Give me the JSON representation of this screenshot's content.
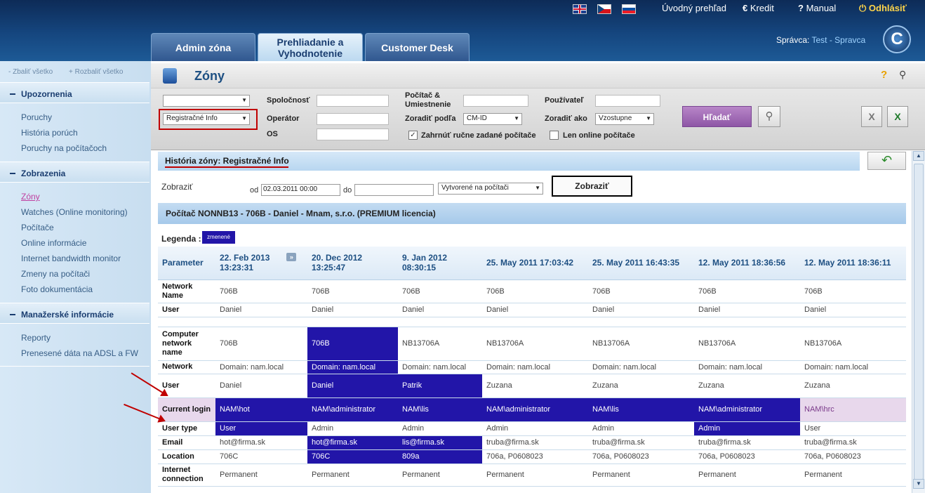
{
  "header": {
    "links": {
      "home": "Úvodný prehľad",
      "kredit": "Kredit",
      "manual": "Manual",
      "logout": "Odhlásiť"
    },
    "admin_prefix": "Správca:",
    "admin_name": "Test - Spravca",
    "logo_letter": "C",
    "tabs": [
      {
        "label": "Admin zóna"
      },
      {
        "label": "Prehliadanie a Vyhodnotenie"
      },
      {
        "label": "Customer Desk"
      }
    ]
  },
  "sidebar": {
    "collapse": "- Zbaliť všetko",
    "expand": "+ Rozbaliť všetko",
    "sections": [
      {
        "title": "Upozornenia",
        "items": [
          "Poruchy",
          "História porúch",
          "Poruchy na počítačoch"
        ]
      },
      {
        "title": "Zobrazenia",
        "items": [
          "Zóny",
          "Watches (Online monitoring)",
          "Počítače",
          "Online informácie",
          "Internet bandwidth monitor",
          "Zmeny na počítači",
          "Foto dokumentácia"
        ]
      },
      {
        "title": "Manažerské informácie",
        "items": [
          "Reporty",
          "Prenesené dáta na ADSL a FW"
        ]
      }
    ]
  },
  "page": {
    "title": "Zóny",
    "help": "?"
  },
  "filters": {
    "zone_select": "",
    "type_select": "Registračné Info",
    "company_label": "Spoločnosť",
    "operator_label": "Operátor",
    "os_label": "OS",
    "computer_label": "Počítač & Umiestnenie",
    "sort_by_label": "Zoradiť podľa",
    "sort_by_value": "CM-ID",
    "user_label": "Používateľ",
    "sort_as_label": "Zoradiť ako",
    "sort_as_value": "Vzostupne",
    "include_manual": "Zahrnúť ručne zadané počítače",
    "online_only": "Len online počítače",
    "search_button": "Hľadať"
  },
  "history": {
    "title": "História zóny: Registračné Info",
    "show_label": "Zobraziť",
    "from_label": "od",
    "from_value": "02.03.2011 00:00",
    "to_label": "do",
    "to_value": "",
    "created_select": "Vytvorené na počítači",
    "show_button": "Zobraziť",
    "computer_title": "Počítač NONNB13 - 706B - Daniel - Mnam, s.r.o. (PREMIUM licencia)",
    "legend_label": "Legenda :",
    "legend_chip": "zmenené"
  },
  "table": {
    "param_header": "Parameter",
    "columns": [
      {
        "date": "22. Feb 2013",
        "time": "13:23:31"
      },
      {
        "date": "20. Dec 2012",
        "time": "13:25:47"
      },
      {
        "date": "9. Jan 2012",
        "time": "08:30:15"
      },
      {
        "date": "25. May 2011 17:03:42",
        "time": ""
      },
      {
        "date": "25. May 2011 16:43:35",
        "time": ""
      },
      {
        "date": "12. May 2011 18:36:56",
        "time": ""
      },
      {
        "date": "12. May 2011 18:36:11",
        "time": ""
      }
    ],
    "rows": [
      {
        "p": "Network Name",
        "v": [
          "706B",
          "706B",
          "706B",
          "706B",
          "706B",
          "706B",
          "706B"
        ]
      },
      {
        "p": "User",
        "v": [
          "Daniel",
          "Daniel",
          "Daniel",
          "Daniel",
          "Daniel",
          "Daniel",
          "Daniel"
        ]
      },
      {
        "p": "Computer network name",
        "v": [
          "706B",
          "706B",
          "NB13706A",
          "NB13706A",
          "NB13706A",
          "NB13706A",
          "NB13706A"
        ]
      },
      {
        "p": "Network",
        "v": [
          "Domain: nam.local",
          "Domain: nam.local",
          "Domain: nam.local",
          "Domain: nam.local",
          "Domain: nam.local",
          "Domain: nam.local",
          "Domain: nam.local"
        ]
      },
      {
        "p": "User",
        "v": [
          "Daniel",
          "Daniel",
          "Patrik",
          "Zuzana",
          "Zuzana",
          "Zuzana",
          "Zuzana"
        ]
      },
      {
        "p": "Current login",
        "v": [
          "NAM\\hot",
          "NAM\\administrator",
          "NAM\\lis",
          "NAM\\administrator",
          "NAM\\lis",
          "NAM\\administrator",
          "NAM\\hrc"
        ]
      },
      {
        "p": "User type",
        "v": [
          "User",
          "Admin",
          "Admin",
          "Admin",
          "Admin",
          "Admin",
          "User"
        ]
      },
      {
        "p": "Email",
        "v": [
          "hot@firma.sk",
          "hot@firma.sk",
          "lis@firma.sk",
          "truba@firma.sk",
          "truba@firma.sk",
          "truba@firma.sk",
          "truba@firma.sk"
        ]
      },
      {
        "p": "Location",
        "v": [
          "706C",
          "706C",
          "809a",
          "706a, P0608023",
          "706a, P0608023",
          "706a, P0608023",
          "706a, P0608023"
        ]
      },
      {
        "p": "Internet connection",
        "v": [
          "Permanent",
          "Permanent",
          "Permanent",
          "Permanent",
          "Permanent",
          "Permanent",
          "Permanent"
        ]
      }
    ]
  },
  "colors": {
    "changed": "#2215a8",
    "highlight": "#c00000",
    "accent": "#1d4f82"
  }
}
